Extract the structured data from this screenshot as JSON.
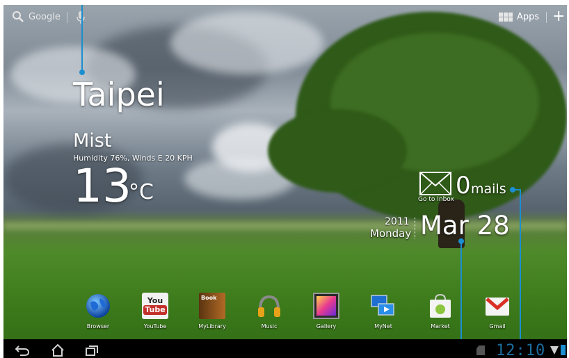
{
  "search": {
    "label": "Google"
  },
  "apps": {
    "label": "Apps"
  },
  "weather": {
    "city": "Taipei",
    "condition": "Mist",
    "details": "Humidity 76%, Winds E 20 KPH",
    "temperature": "13",
    "unit": "°C"
  },
  "mail": {
    "count": "0",
    "label": "mails",
    "inbox_label": "Go to Inbox"
  },
  "date": {
    "year": "2011",
    "weekday": "Monday",
    "date": "Mar 28"
  },
  "dock": {
    "apps": [
      {
        "label": "Browser",
        "icon": "globe-icon"
      },
      {
        "label": "YouTube",
        "icon": "youtube-icon",
        "icon_text_top": "You",
        "icon_text_bottom": "Tube"
      },
      {
        "label": "MyLibrary",
        "icon": "book-icon",
        "icon_text": "Book"
      },
      {
        "label": "Music",
        "icon": "headphones-icon"
      },
      {
        "label": "Gallery",
        "icon": "gallery-icon"
      },
      {
        "label": "MyNet",
        "icon": "mynet-icon"
      },
      {
        "label": "Market",
        "icon": "market-icon"
      },
      {
        "label": "Gmail",
        "icon": "gmail-icon"
      }
    ]
  },
  "statusbar": {
    "time": "12:10"
  },
  "colors": {
    "accent": "#1b8fd0",
    "clock": "#1b6e9f"
  }
}
